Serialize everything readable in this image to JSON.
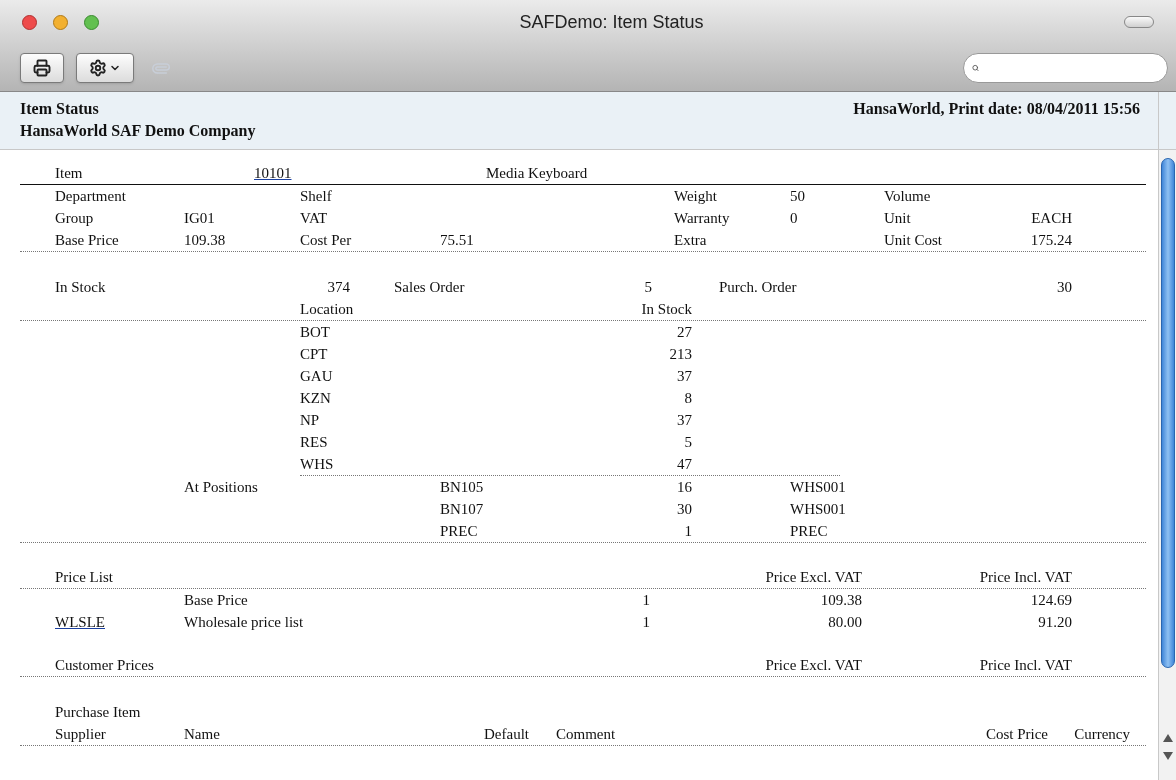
{
  "window": {
    "title": "SAFDemo: Item Status"
  },
  "toolbar": [
    {
      "kind": "print",
      "disabled": false
    },
    {
      "kind": "settings",
      "disabled": false
    },
    {
      "kind": "attach",
      "disabled": true
    }
  ],
  "report_header": {
    "title": "Item Status",
    "company": "HansaWorld SAF Demo Company",
    "print_info": "HansaWorld, Print date: 08/04/2011 15:56"
  },
  "item": {
    "label": "Item",
    "code": "10101",
    "name": "Media Keyboard"
  },
  "details": [
    [
      {
        "label": "Department"
      },
      {
        "label": "Shelf"
      },
      {
        "label": "Weight",
        "value": "50"
      },
      {
        "label": "Volume"
      }
    ],
    [
      {
        "label": "Group",
        "value": "IG01"
      },
      {
        "label": "VAT"
      },
      {
        "label": "Warranty",
        "value": "0"
      },
      {
        "label": "Unit",
        "value": "EACH"
      }
    ],
    [
      {
        "label": "Base Price",
        "value": "109.38"
      },
      {
        "label": "Cost Per",
        "value": "75.51"
      },
      {
        "label": "Extra"
      },
      {
        "label": "Unit Cost",
        "value": "175.24"
      }
    ]
  ],
  "stock": {
    "in_stock_label": "In Stock",
    "in_stock": "374",
    "sales_order_label": "Sales Order",
    "sales_order": "5",
    "purch_order_label": "Purch. Order",
    "purch_order": "30"
  },
  "locations": {
    "columns": [
      "Location",
      "In Stock"
    ],
    "rows": [
      {
        "code": "BOT",
        "in_stock": "27"
      },
      {
        "code": "CPT",
        "in_stock": "213"
      },
      {
        "code": "GAU",
        "in_stock": "37"
      },
      {
        "code": "KZN",
        "in_stock": "8"
      },
      {
        "code": "NP",
        "in_stock": "37"
      },
      {
        "code": "RES",
        "in_stock": "5"
      },
      {
        "code": "WHS",
        "in_stock": "47"
      }
    ]
  },
  "positions": {
    "label": "At Positions",
    "rows": [
      {
        "position": "BN105",
        "qty": "16",
        "location": "WHS001"
      },
      {
        "position": "BN107",
        "qty": "30",
        "location": "WHS001"
      },
      {
        "position": "PREC",
        "qty": "1",
        "location": "PREC"
      }
    ]
  },
  "price_list": {
    "label": "Price List",
    "columns": [
      "Price Excl. VAT",
      "Price Incl. VAT"
    ],
    "rows": [
      {
        "name": "Base Price",
        "qty": "1",
        "excl": "109.38",
        "incl": "124.69"
      },
      {
        "code": "WLSLE",
        "name": "Wholesale price list",
        "qty": "1",
        "excl": "80.00",
        "incl": "91.20"
      }
    ]
  },
  "customer_prices": {
    "label": "Customer Prices",
    "columns": [
      "Price Excl. VAT",
      "Price Incl. VAT"
    ]
  },
  "purchase_item": {
    "label": "Purchase Item",
    "columns": [
      "Supplier",
      "Name",
      "Default",
      "Comment",
      "Cost Price",
      "Currency"
    ]
  }
}
